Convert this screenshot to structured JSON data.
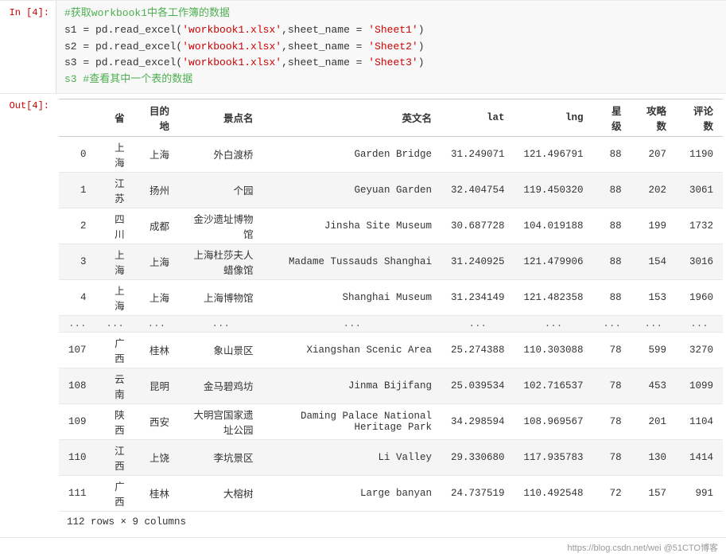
{
  "cell_in_label": "In  [4]:",
  "cell_out_label": "Out[4]:",
  "code": {
    "comment1": "#获取workbook1中各工作簿的数据",
    "line1": "s1 = pd.read_excel('workbook1.xlsx',sheet_name = 'Sheet1')",
    "line2": "s2 = pd.read_excel('workbook1.xlsx',sheet_name = 'Sheet2')",
    "line3": "s3 = pd.read_excel('workbook1.xlsx',sheet_name = 'Sheet3')",
    "comment2": "s3 #查看其中一个表的数据"
  },
  "table": {
    "headers": [
      "",
      "省",
      "目的地",
      "景点名",
      "英文名",
      "lat",
      "lng",
      "星级",
      "攻略数",
      "评论数"
    ],
    "rows": [
      [
        "0",
        "上海",
        "上海",
        "外白渡桥",
        "Garden Bridge",
        "31.249071",
        "121.496791",
        "88",
        "207",
        "1190"
      ],
      [
        "1",
        "江苏",
        "扬州",
        "个园",
        "Geyuan Garden",
        "32.404754",
        "119.450320",
        "88",
        "202",
        "3061"
      ],
      [
        "2",
        "四川",
        "成都",
        "金沙遗址博物馆",
        "Jinsha Site Museum",
        "30.687728",
        "104.019188",
        "88",
        "199",
        "1732"
      ],
      [
        "3",
        "上海",
        "上海",
        "上海杜莎夫人蜡像馆",
        "Madame Tussauds Shanghai",
        "31.240925",
        "121.479906",
        "88",
        "154",
        "3016"
      ],
      [
        "4",
        "上海",
        "上海",
        "上海博物馆",
        "Shanghai Museum",
        "31.234149",
        "121.482358",
        "88",
        "153",
        "1960"
      ]
    ],
    "dots_row": [
      "...",
      "...",
      "...",
      "...",
      "...",
      "...",
      "...",
      "...",
      "...",
      "..."
    ],
    "rows2": [
      [
        "107",
        "广西",
        "桂林",
        "象山景区",
        "Xiangshan Scenic Area",
        "25.274388",
        "110.303088",
        "78",
        "599",
        "3270"
      ],
      [
        "108",
        "云南",
        "昆明",
        "金马碧鸡坊",
        "Jinma Bijifang",
        "25.039534",
        "102.716537",
        "78",
        "453",
        "1099"
      ],
      [
        "109",
        "陕西",
        "西安",
        "大明宫国家遗址公园",
        "Daming Palace National Heritage Park",
        "34.298594",
        "108.969567",
        "78",
        "201",
        "1104"
      ],
      [
        "110",
        "江西",
        "上饶",
        "李坑景区",
        "Li Valley",
        "29.330680",
        "117.935783",
        "78",
        "130",
        "1414"
      ],
      [
        "111",
        "广西",
        "桂林",
        "大榕树",
        "Large banyan",
        "24.737519",
        "110.492548",
        "72",
        "157",
        "991"
      ]
    ],
    "row_count": "112 rows × 9 columns"
  },
  "footer": {
    "csdn_text": "https://blog.csdn.net/wei  @51CTO博客"
  }
}
